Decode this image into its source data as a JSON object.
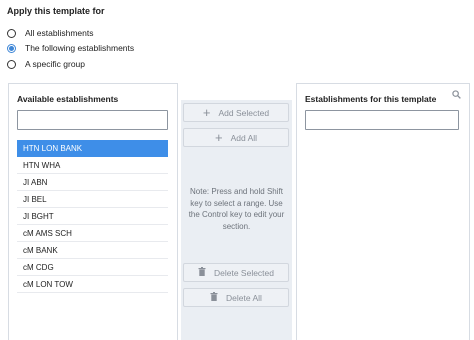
{
  "apply_section": {
    "heading": "Apply this template for",
    "options": [
      {
        "label": "All establishments",
        "checked": false
      },
      {
        "label": "The following establishments",
        "checked": true
      },
      {
        "label": "A specific group",
        "checked": false
      }
    ]
  },
  "available": {
    "title": "Available establishments",
    "search_value": "",
    "items": [
      "HTN LON BANK",
      "HTN WHA",
      "JI ABN",
      "JI BEL",
      "JI BGHT",
      "cM AMS SCH",
      "cM BANK",
      "cM CDG",
      "cM LON TOW"
    ],
    "selected_index": 0
  },
  "actions": {
    "add_selected": "Add Selected",
    "add_all": "Add All",
    "note": "Note: Press and hold Shift key to select a range. Use the Control key to edit your section.",
    "delete_selected": "Delete Selected",
    "delete_all": "Delete All"
  },
  "assigned": {
    "title": "Establishments for this template",
    "search_value": ""
  },
  "colors": {
    "accent": "#3e8ee8",
    "middle_bg": "#eaeef3"
  },
  "icons": {
    "search": "search-icon",
    "add": "plus-icon",
    "delete": "trash-icon"
  }
}
